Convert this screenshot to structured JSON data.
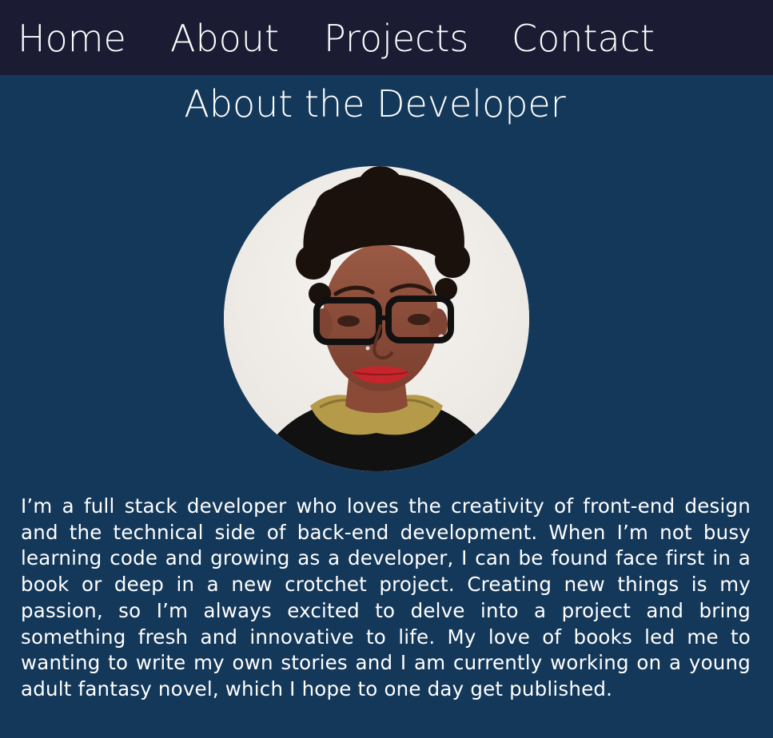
{
  "nav": {
    "items": [
      {
        "label": "Home"
      },
      {
        "label": "About"
      },
      {
        "label": "Projects"
      },
      {
        "label": "Contact"
      }
    ]
  },
  "main": {
    "title": "About the Developer",
    "avatar_icon": "portrait-photo",
    "bio": "I’m a full stack developer who loves the creativity of front-end design and the technical side of back-end development. When I’m not busy learning code and growing as a developer, I can be found face first in a book or deep in a new crotchet project. Creating new things is my passion, so I’m always excited to delve into a project and bring something fresh and innovative to life. My love of books led me to wanting to write my own stories and I am currently working on a young adult fantasy novel, which I hope to one day get published."
  },
  "colors": {
    "nav_background": "#1b1c33",
    "page_background": "#14385a",
    "text": "#ffffff"
  }
}
